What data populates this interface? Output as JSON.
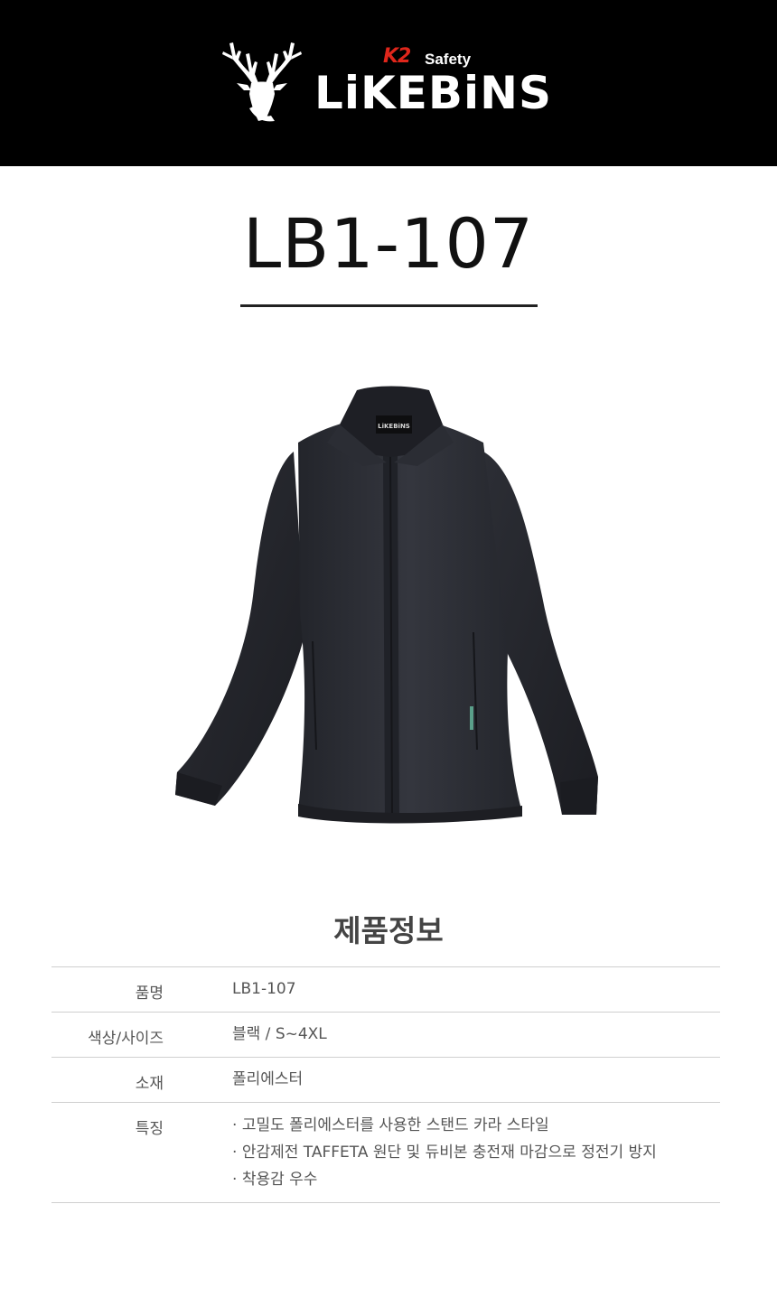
{
  "header": {
    "brand_badge": "K2",
    "brand_sub": "Safety",
    "brand_name": "LiKEBiNS"
  },
  "product": {
    "code": "LB1-107",
    "jacket_label": "LiKEBiNS"
  },
  "info": {
    "heading": "제품정보",
    "rows": [
      {
        "label": "품명",
        "value": "LB1-107"
      },
      {
        "label": "색상/사이즈",
        "value": "블랙 / S~4XL"
      },
      {
        "label": "소재",
        "value": "폴리에스터"
      },
      {
        "label": "특징",
        "features": [
          "고밀도 폴리에스터를 사용한 스탠드 카라 스타일",
          "안감제전 TAFFETA 원단 및 듀비본 충전재 마감으로 정전기 방지",
          "착용감 우수"
        ]
      }
    ]
  },
  "colors": {
    "banner": "#000000",
    "brand_red": "#e0261b",
    "jacket": "#2a2c33"
  }
}
